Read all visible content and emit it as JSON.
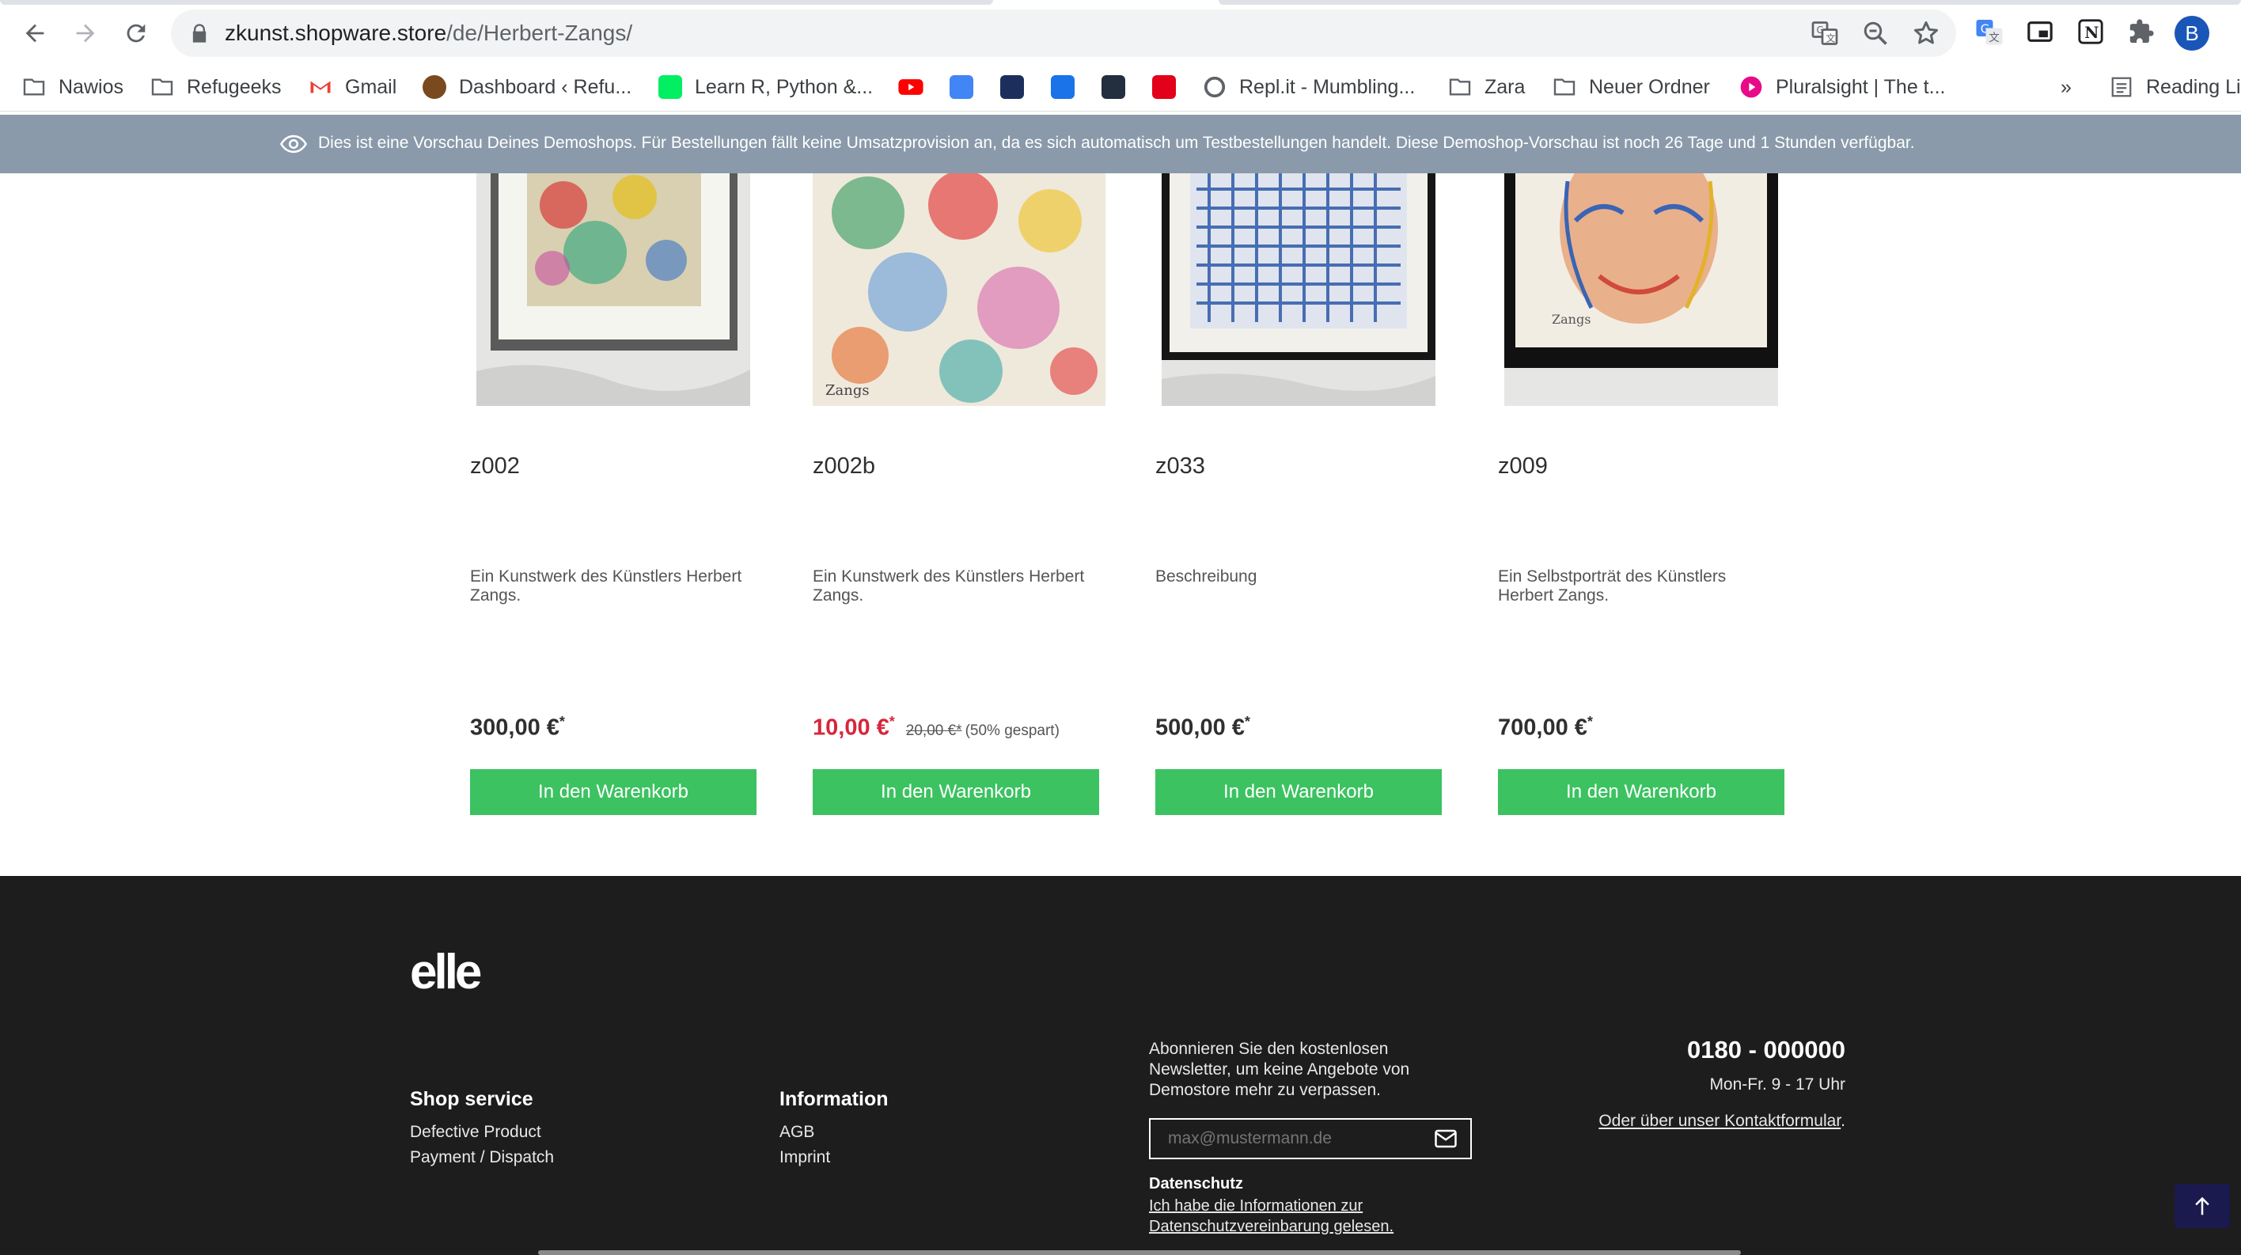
{
  "browser": {
    "url_host": "zkunst.shopware.store",
    "url_path": "/de/Herbert-Zangs/",
    "avatar_letter": "B",
    "icons": [
      "back-icon",
      "forward-icon",
      "reload-icon",
      "lock-icon",
      "translate-icon",
      "zoom-icon",
      "star-icon",
      "extensions-icon"
    ]
  },
  "bookmarks": {
    "items": [
      {
        "label": "Nawios",
        "icon": "folder-icon"
      },
      {
        "label": "Refugeeks",
        "icon": "folder-icon"
      },
      {
        "label": "Gmail",
        "icon": "gmail-icon"
      },
      {
        "label": "Dashboard ‹ Refu...",
        "icon": "site-icon"
      },
      {
        "label": "Learn R, Python &...",
        "icon": "datacamp-icon"
      },
      {
        "label": "Repl.it - Mumbling...",
        "icon": "replit-icon"
      },
      {
        "label": "Zara",
        "icon": "folder-icon"
      },
      {
        "label": "Neuer Ordner",
        "icon": "folder-icon"
      },
      {
        "label": "Pluralsight | The t...",
        "icon": "pluralsight-icon"
      }
    ],
    "overflow": "»",
    "reading_list": "Reading Li"
  },
  "preview_banner": {
    "text": "Dies ist eine Vorschau Deines Demoshops. Für Bestellungen fällt keine Umsatzprovision an, da es sich automatisch um Testbestellungen handelt. Diese Demoshop-Vorschau ist noch 26 Tage und 1 Stunden verfügbar."
  },
  "products": [
    {
      "name": "z002",
      "description": "Ein Kunstwerk des Künstlers Herbert Zangs.",
      "price": "300,00 €",
      "asterisk": "*",
      "cart_label": "In den Warenkorb"
    },
    {
      "name": "z002b",
      "description": "Ein Kunstwerk des Künstlers Herbert Zangs.",
      "price": "10,00 €",
      "asterisk": "*",
      "old_price": "20,00 €*",
      "saved": "(50% gespart)",
      "cart_label": "In den Warenkorb"
    },
    {
      "name": "z033",
      "description": "Beschreibung",
      "price": "500,00 €",
      "asterisk": "*",
      "cart_label": "In den Warenkorb"
    },
    {
      "name": "z009",
      "description": "Ein Selbstporträt des Künstlers Herbert Zangs.",
      "price": "700,00 €",
      "asterisk": "*",
      "cart_label": "In den Warenkorb"
    }
  ],
  "footer": {
    "logo": "elle",
    "shop_service": {
      "heading": "Shop service",
      "links": [
        "Defective Product",
        "Payment / Dispatch"
      ]
    },
    "information": {
      "heading": "Information",
      "links": [
        "AGB",
        "Imprint"
      ]
    },
    "newsletter": {
      "text": "Abonnieren Sie den kostenlosen Newsletter, um keine Angebote von Demostore mehr zu verpassen.",
      "placeholder": "max@mustermann.de",
      "privacy_heading": "Datenschutz",
      "privacy_link": "Ich habe die Informationen zur Datenschutzvereinbarung gelesen."
    },
    "hotline": {
      "phone": "0180 - 000000",
      "hours": "Mon-Fr. 9 - 17 Uhr",
      "contact_link": "Oder über unser Kontaktformular",
      "contact_suffix": "."
    }
  }
}
